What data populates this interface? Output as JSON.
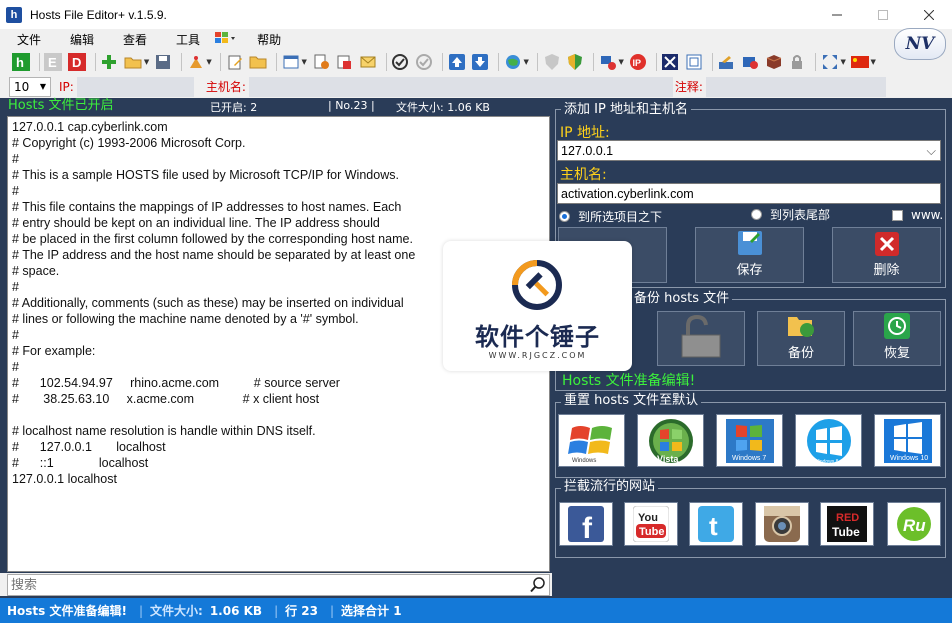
{
  "window": {
    "title": "Hosts File Editor+ v.1.5.9.",
    "app_icon_text": "h"
  },
  "menu": [
    {
      "label": "文件"
    },
    {
      "label": "编辑"
    },
    {
      "label": "查看"
    },
    {
      "label": "工具"
    },
    {
      "label": "帮助"
    }
  ],
  "brand_logo": "NV",
  "filter": {
    "count": "10",
    "ip_label": "IP:",
    "host_label": "主机名:",
    "note_label": "注释:"
  },
  "info": {
    "status": "Hosts 文件已开启",
    "enabled": "已开启: 2",
    "line_no": "| No.23 |",
    "file_size": "文件大小: 1.06 KB"
  },
  "editor_lines": [
    "127.0.0.1 cap.cyberlink.com",
    "# Copyright (c) 1993-2006 Microsoft Corp.",
    "#",
    "# This is a sample HOSTS file used by Microsoft TCP/IP for Windows.",
    "#",
    "# This file contains the mappings of IP addresses to host names. Each",
    "# entry should be kept on an individual line. The IP address should",
    "# be placed in the first column followed by the corresponding host name.",
    "# The IP address and the host name should be separated by at least one",
    "# space.",
    "#",
    "# Additionally, comments (such as these) may be inserted on individual",
    "# lines or following the machine name denoted by a '#' symbol.",
    "#",
    "# For example:",
    "#",
    "#      102.54.94.97     rhino.acme.com          # source server",
    "#       38.25.63.10     x.acme.com              # x client host",
    "",
    "# localhost name resolution is handle within DNS itself.",
    "#      127.0.0.1       localhost",
    "#      ::1             localhost",
    "127.0.0.1 localhost"
  ],
  "search": {
    "placeholder": "搜索"
  },
  "add_group": {
    "title": "添加 IP 地址和主机名",
    "ip_label": "IP 地址:",
    "ip_value": "127.0.0.1",
    "host_label": "主机名:",
    "host_value": "activation.cyberlink.com",
    "radio_selected": "到所选项目之下",
    "radio_end": "到列表尾部",
    "www_label": "www.",
    "save_label": "保存",
    "delete_label": "删除"
  },
  "backup_group": {
    "title": "备份 hosts 文件",
    "backup_label": "备份",
    "restore_label": "恢复",
    "message": "Hosts 文件准备编辑!"
  },
  "reset_group": {
    "title": "重置 hosts 文件至默认",
    "os": [
      {
        "name": "windows-xp-icon",
        "label": "Windows"
      },
      {
        "name": "windows-vista-icon",
        "label": "Vista"
      },
      {
        "name": "windows-7-icon",
        "label": "Windows 7"
      },
      {
        "name": "windows-8-icon",
        "label": "Windows 8"
      },
      {
        "name": "windows-10-icon",
        "label": "Windows 10"
      }
    ]
  },
  "block_group": {
    "title": "拦截流行的网站",
    "sites": [
      {
        "name": "facebook-icon",
        "glyph": "f"
      },
      {
        "name": "youtube-icon",
        "glyph": "You Tube"
      },
      {
        "name": "twitter-icon",
        "glyph": "t"
      },
      {
        "name": "instagram-icon",
        "glyph": ""
      },
      {
        "name": "redtube-icon",
        "glyph": "RED Tube"
      },
      {
        "name": "rutube-icon",
        "glyph": "Ru"
      }
    ]
  },
  "statusbar": {
    "message": "Hosts 文件准备编辑!",
    "size_label": "文件大小:",
    "size_value": "1.06 KB",
    "line": "行 23",
    "selection": "选择合计 1"
  },
  "watermark": {
    "title": "软件个锤子",
    "url": "WWW.RJGCZ.COM"
  },
  "colors": {
    "panel_bg": "#2a3c58",
    "status_green": "#3cf03c",
    "label_yellow": "#ffd21a",
    "statusbar_blue": "#1479d8",
    "filter_red": "#d40000"
  }
}
